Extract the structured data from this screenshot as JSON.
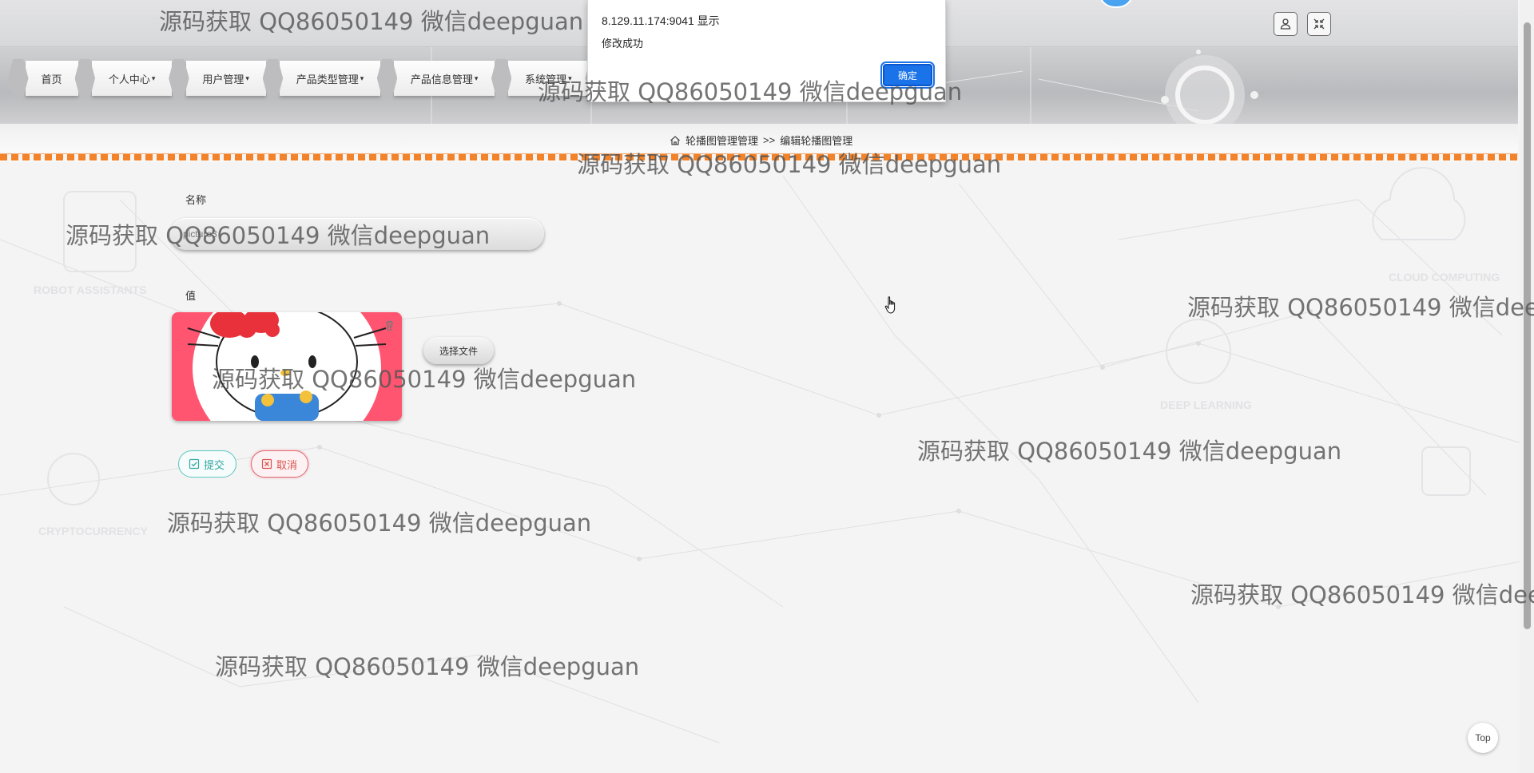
{
  "top_icons": [
    {
      "name": "user-icon"
    },
    {
      "name": "exit-fullscreen-icon"
    }
  ],
  "nav": {
    "items": [
      {
        "label": "首页",
        "caret": ""
      },
      {
        "label": "个人中心",
        "caret": "▾"
      },
      {
        "label": "用户管理",
        "caret": "▾"
      },
      {
        "label": "产品类型管理",
        "caret": "▾"
      },
      {
        "label": "产品信息管理",
        "caret": "▾"
      },
      {
        "label": "系统管理",
        "caret": "▾"
      }
    ]
  },
  "breadcrumb": {
    "home_icon": "home-icon",
    "parent": "轮播图管理管理",
    "separator": ">>",
    "current": "编辑轮播图管理"
  },
  "form": {
    "name_label": "名称",
    "name_value": "picture3",
    "value_label": "值",
    "image_alt": "Hello Kitty",
    "choose_file": "选择文件",
    "submit": "提交",
    "cancel": "取消"
  },
  "dialog": {
    "origin": "8.129.11.174:9041 显示",
    "message": "修改成功",
    "ok": "确定"
  },
  "background_text": {
    "robot": "ROBOT ASSISTANTS",
    "cloud": "CLOUD COMPUTING",
    "deep": "DEEP LEARNING",
    "crypto": "CRYPTOCURRENCY"
  },
  "watermark_text": "源码获取 QQ86050149 微信deepguan",
  "top_button": "Top",
  "colors": {
    "stitch": "#f2832a",
    "submit": "#34a8a2",
    "cancel": "#d9534f",
    "dialog_ok": "#1a73e8"
  }
}
